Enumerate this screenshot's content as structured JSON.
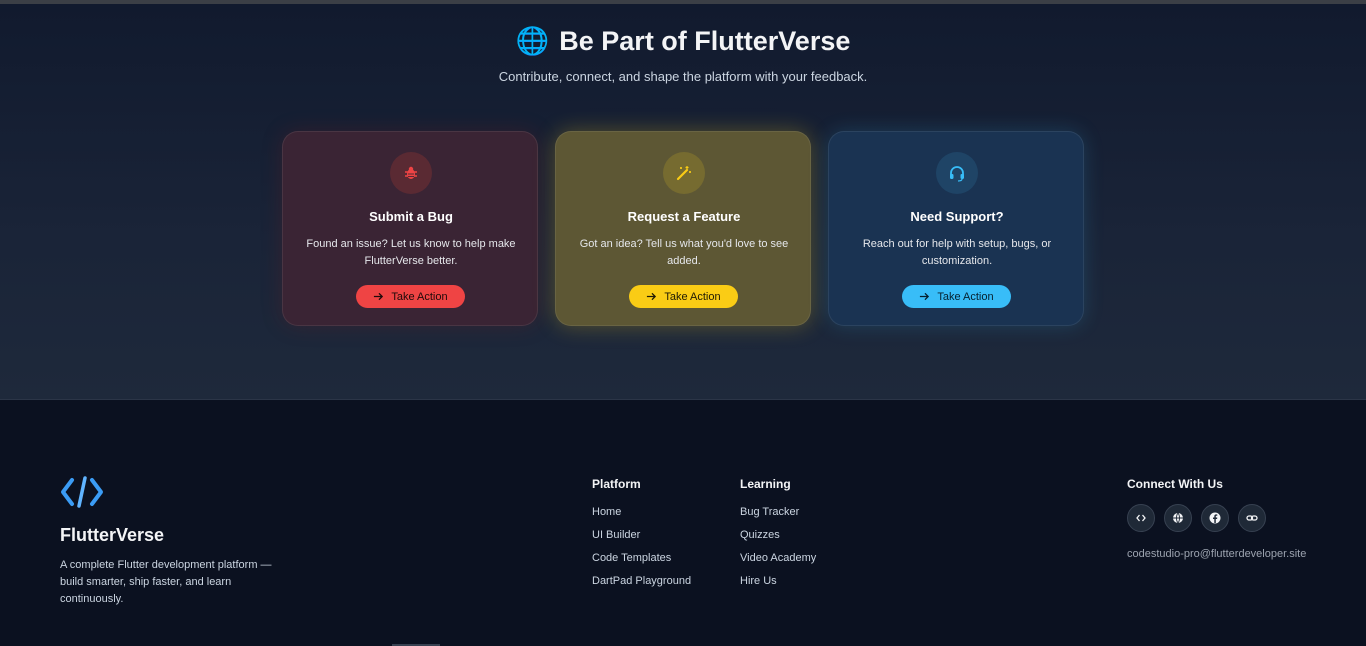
{
  "hero": {
    "title": "Be Part of FlutterVerse",
    "subtitle": "Contribute, connect, and shape the platform with your feedback."
  },
  "cards": [
    {
      "title": "Submit a Bug",
      "desc": "Found an issue? Let us know to help make FlutterVerse better.",
      "button": "Take Action",
      "icon": "bug-icon",
      "accent": "#ef4444"
    },
    {
      "title": "Request a Feature",
      "desc": "Got an idea? Tell us what you'd love to see added.",
      "button": "Take Action",
      "icon": "magic-wand-icon",
      "accent": "#facc15"
    },
    {
      "title": "Need Support?",
      "desc": "Reach out for help with setup, bugs, or customization.",
      "button": "Take Action",
      "icon": "headset-icon",
      "accent": "#38bdf8"
    }
  ],
  "footer": {
    "brand": "FlutterVerse",
    "description": "A complete Flutter development platform — build smarter, ship faster, and learn continuously.",
    "platform": {
      "title": "Platform",
      "links": [
        "Home",
        "UI Builder",
        "Code Templates",
        "DartPad Playground"
      ]
    },
    "learning": {
      "title": "Learning",
      "links": [
        "Bug Tracker",
        "Quizzes",
        "Video Academy",
        "Hire Us"
      ]
    },
    "connect": {
      "title": "Connect With Us",
      "socials": [
        "code-icon",
        "globe-icon",
        "facebook-icon",
        "link-icon"
      ],
      "email": "codestudio-pro@flutterdeveloper.site"
    }
  }
}
